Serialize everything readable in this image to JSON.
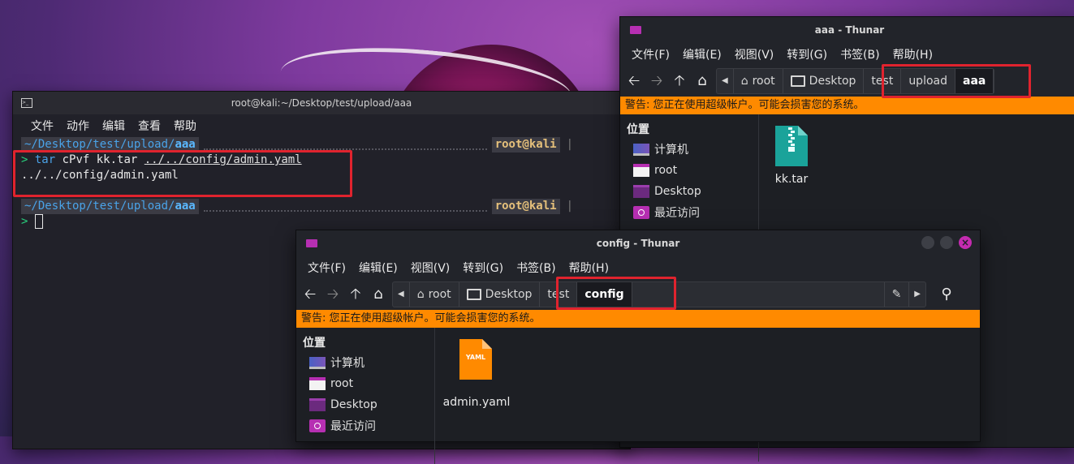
{
  "terminal": {
    "title": "root@kali:~/Desktop/test/upload/aaa",
    "menu": [
      "文件",
      "动作",
      "编辑",
      "查看",
      "帮助"
    ],
    "prompt_path_prefix": "~/Desktop/test/upload/",
    "prompt_path_dir": "aaa",
    "prompt_user": "root@kali",
    "prompt_sep": "|",
    "caret": ">",
    "command_keyword": "tar",
    "command_rest": " cPvf kk.tar ",
    "command_arg": "../../config/admin.yaml",
    "output": "../../config/admin.yaml"
  },
  "thunar_aaa": {
    "title": "aaa - Thunar",
    "menu": [
      "文件(F)",
      "编辑(E)",
      "视图(V)",
      "转到(G)",
      "书签(B)",
      "帮助(H)"
    ],
    "path": [
      "root",
      "Desktop",
      "test",
      "upload",
      "aaa"
    ],
    "warning": "警告: 您正在使用超级帐户。可能会损害您的系统。",
    "sidebar_heading": "位置",
    "sidebar": [
      "计算机",
      "root",
      "Desktop",
      "最近访问"
    ],
    "file_name": "kk.tar",
    "file_icon": "archive-zip-icon"
  },
  "thunar_config": {
    "title": "config - Thunar",
    "menu": [
      "文件(F)",
      "编辑(E)",
      "视图(V)",
      "转到(G)",
      "书签(B)",
      "帮助(H)"
    ],
    "path": [
      "root",
      "Desktop",
      "test",
      "config"
    ],
    "warning": "警告: 您正在使用超级帐户。可能会损害您的系统。",
    "sidebar_heading": "位置",
    "sidebar": [
      "计算机",
      "root",
      "Desktop",
      "最近访问"
    ],
    "file_name": "admin.yaml",
    "file_icon_text": "YAML",
    "close_glyph": "×"
  },
  "colors": {
    "warning_bg": "#ff8a00",
    "highlight_box": "#e0232e",
    "accent_purple": "#b62fb2"
  }
}
